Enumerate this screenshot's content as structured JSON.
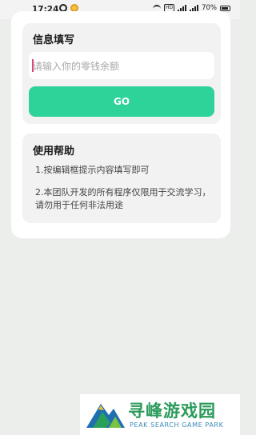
{
  "status_bar": {
    "time": "17:24",
    "network_badge": "HD",
    "battery_percent": "70%",
    "app_icons": [
      "qq-icon",
      "weibo-icon"
    ]
  },
  "info_panel": {
    "title": "信息填写",
    "input": {
      "placeholder": "请输入你的零钱余额",
      "value": ""
    },
    "go_label": "GO"
  },
  "help_panel": {
    "title": "使用帮助",
    "items": [
      "1.按编辑框提示内容填写即可",
      "2.本团队开发的所有程序仅限用于交流学习，请勿用于任何非法用途"
    ]
  },
  "watermark": {
    "title": "寻峰游戏园",
    "subtitle": "PEAK SEARCH GAME PARK"
  },
  "colors": {
    "accent": "#2ed39a",
    "background": "#eceeec",
    "card": "#ffffff",
    "panel": "#f2f2f2"
  }
}
